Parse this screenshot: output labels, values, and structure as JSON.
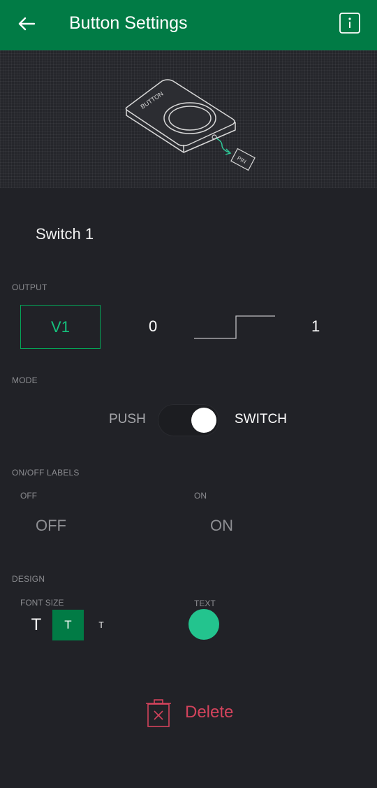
{
  "header": {
    "title": "Button Settings",
    "back_icon": "arrow-left-icon",
    "info_icon": "info-icon",
    "bg_color": "#017b45"
  },
  "illustration": {
    "device_label": "BUTTON",
    "pin_label": "PIN"
  },
  "widget": {
    "name": "Switch 1"
  },
  "output": {
    "section_label": "OUTPUT",
    "pin": "V1",
    "min_value": "0",
    "max_value": "1"
  },
  "mode": {
    "section_label": "MODE",
    "push_label": "PUSH",
    "switch_label": "SWITCH",
    "selected": "SWITCH"
  },
  "labels": {
    "section_label": "ON/OFF LABELS",
    "off_caption": "OFF",
    "on_caption": "ON",
    "off_placeholder": "OFF",
    "on_placeholder": "ON"
  },
  "design": {
    "section_label": "DESIGN",
    "font_size_label": "FONT SIZE",
    "font_sizes": [
      "T",
      "T",
      "T"
    ],
    "selected_font_size_index": 1,
    "text_color_label": "TEXT",
    "text_color": "#23c48e"
  },
  "actions": {
    "delete_label": "Delete",
    "delete_icon": "trash-icon",
    "delete_color": "#d3435c"
  },
  "colors": {
    "background": "#212227",
    "accent": "#017b45",
    "pin_border": "#05a457",
    "pin_text": "#15c27d"
  }
}
